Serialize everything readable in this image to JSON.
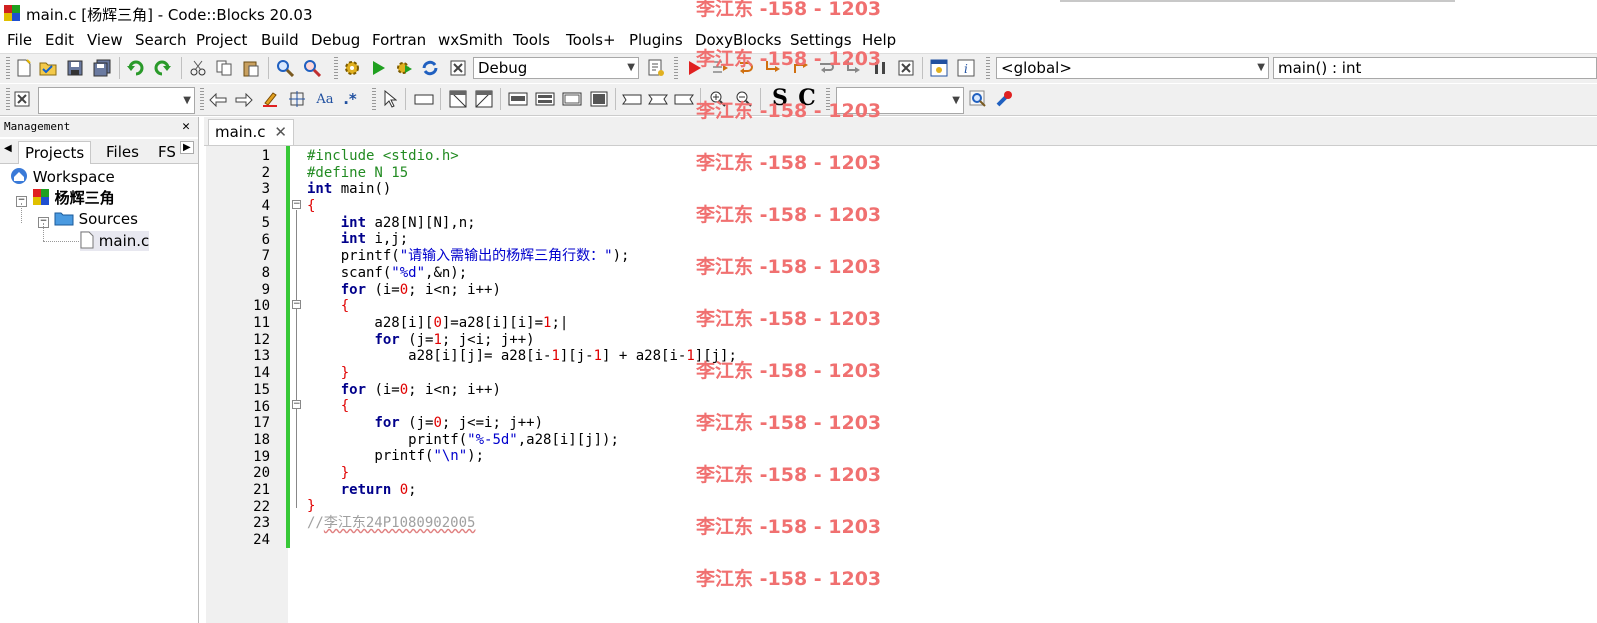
{
  "window": {
    "title": "main.c [杨辉三角] - Code::Blocks 20.03"
  },
  "menu": [
    "File",
    "Edit",
    "View",
    "Search",
    "Project",
    "Build",
    "Debug",
    "Fortran",
    "wxSmith",
    "Tools",
    "Tools+",
    "Plugins",
    "DoxyBlocks",
    "Settings",
    "Help"
  ],
  "toolbar": {
    "build_target": "Debug",
    "scope_combo": "<global>",
    "symbol_combo": "main() : int",
    "search_combo": "",
    "zoom_combo": "",
    "icons": {
      "new": "new-file-icon",
      "open": "open-icon",
      "save": "save-icon",
      "save_all": "save-all-icon",
      "undo": "undo-icon",
      "redo": "redo-icon",
      "cut": "cut-icon",
      "copy": "copy-icon",
      "paste": "paste-icon",
      "find": "find-icon",
      "replace": "replace-icon",
      "build": "gear-icon",
      "run": "run-icon",
      "build_run": "build-run-icon",
      "rebuild": "rebuild-icon",
      "abort": "abort-icon"
    },
    "text_buttons": {
      "s": "S",
      "c": "C",
      "aa": "Aa",
      "regex": ".*"
    }
  },
  "management": {
    "header": "Management",
    "tabs": [
      "Projects",
      "Files",
      "FS"
    ],
    "tree": {
      "workspace": "Workspace",
      "project": "杨辉三角",
      "sources": "Sources",
      "file": "main.c"
    }
  },
  "editor": {
    "tab_label": "main.c",
    "line_numbers": [
      "1",
      "2",
      "3",
      "4",
      "5",
      "6",
      "7",
      "8",
      "9",
      "10",
      "11",
      "12",
      "13",
      "14",
      "15",
      "16",
      "17",
      "18",
      "19",
      "20",
      "21",
      "22",
      "23",
      "24"
    ]
  },
  "watermark": {
    "text": "李江东 -158 - 1203"
  },
  "colors": {
    "watermark": "#f07070",
    "change_bar": "#37c837",
    "keyword": "#00008b",
    "preprocessor": "#228b22",
    "string": "#0000cd",
    "number": "#e00000"
  }
}
